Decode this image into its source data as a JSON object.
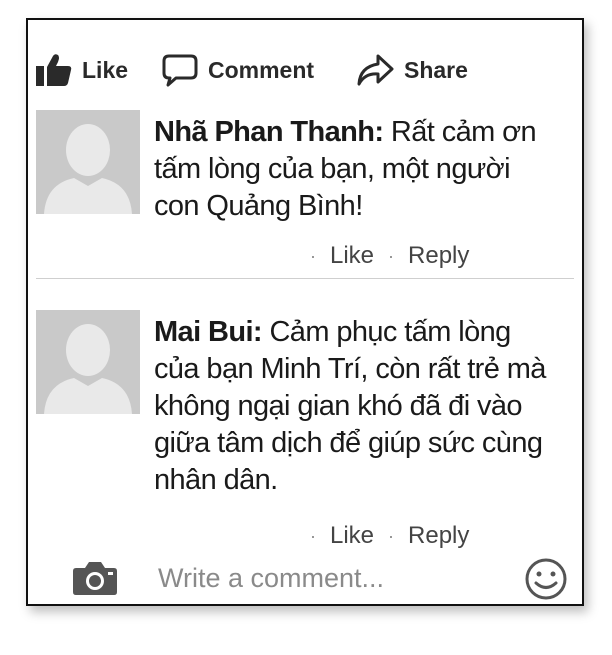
{
  "actions": {
    "like_label": "Like",
    "comment_label": "Comment",
    "share_label": "Share"
  },
  "comments": [
    {
      "author": "Nhã Phan Thanh:",
      "text": " Rất cảm ơn tấm lòng của bạn, một người con Quảng Bình!",
      "like_label": "Like",
      "reply_label": "Reply",
      "separator": "·"
    },
    {
      "author": "Mai Bui:",
      "text": " Cảm phục tấm lòng của bạn Minh Trí, còn rất trẻ mà không ngại gian khó đã đi vào giữa tâm dịch để giúp sức cùng nhân dân.",
      "like_label": "Like",
      "reply_label": "Reply",
      "separator": "·"
    }
  ],
  "composer": {
    "placeholder": "Write a comment..."
  },
  "icons": {
    "like": "thumbs-up-icon",
    "comment": "speech-bubble-icon",
    "share": "share-arrow-icon",
    "camera": "camera-icon",
    "emoji": "smiley-icon",
    "avatar": "default-avatar"
  }
}
